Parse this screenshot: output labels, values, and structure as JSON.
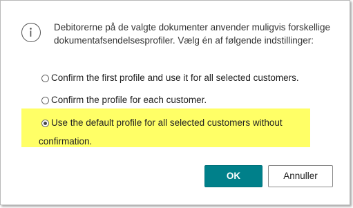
{
  "dialog": {
    "message": "Debitorerne på de valgte dokumenter anvender muligvis forskellige dokumentafsendelsesprofiler. Vælg én af følgende indstillinger:",
    "options": [
      {
        "label": "Confirm the first profile and use it for all selected customers.",
        "selected": false
      },
      {
        "label": "Confirm the profile for each customer.",
        "selected": false
      },
      {
        "label_line1": "Use the default profile for all selected customers without",
        "label_line2": "confirmation.",
        "selected": true
      }
    ],
    "ok_label": "OK",
    "cancel_label": "Annuller",
    "highlight_color": "#ffff66",
    "accent_color": "#00808a"
  }
}
